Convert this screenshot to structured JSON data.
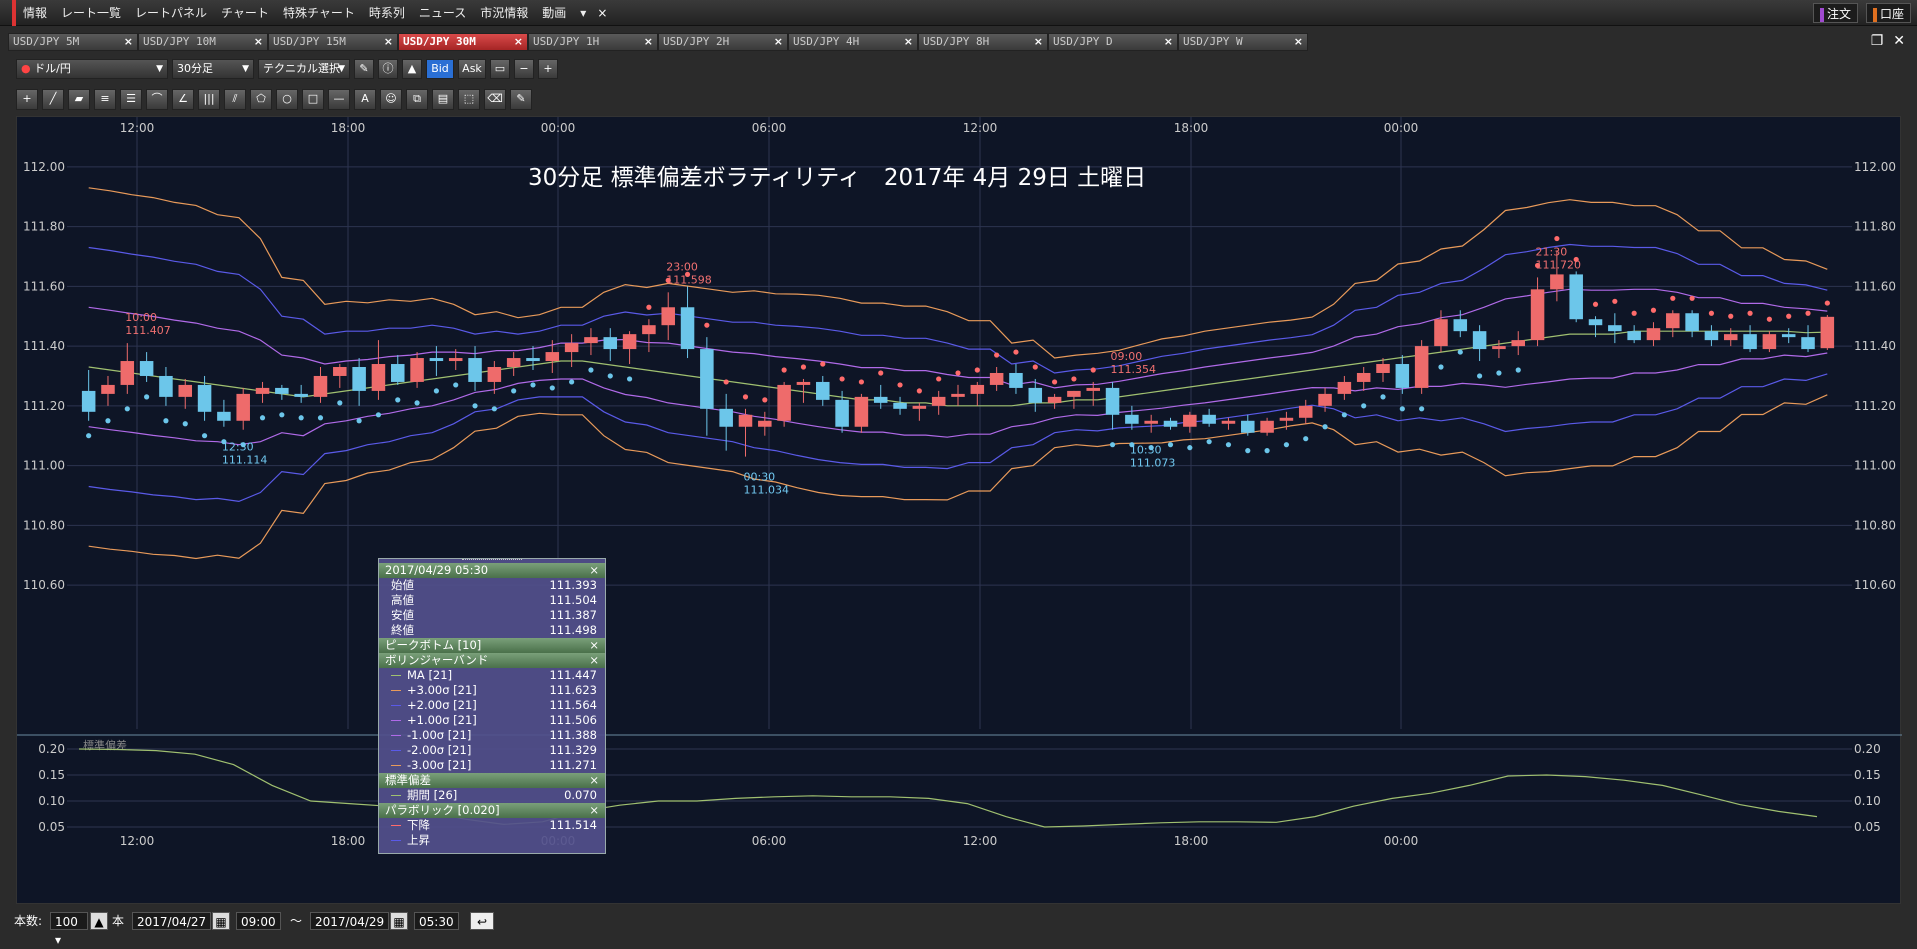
{
  "menu": {
    "items": [
      "情報",
      "レート一覧",
      "レートパネル",
      "チャート",
      "特殊チャート",
      "時系列",
      "ニュース",
      "市況情報",
      "動画"
    ],
    "more": "▾",
    "close": "×",
    "order_label": "注文",
    "account_label": "口座"
  },
  "tabs": [
    {
      "label": "USD/JPY 5M"
    },
    {
      "label": "USD/JPY 10M"
    },
    {
      "label": "USD/JPY 15M"
    },
    {
      "label": "USD/JPY 30M",
      "active": true
    },
    {
      "label": "USD/JPY 1H"
    },
    {
      "label": "USD/JPY 2H"
    },
    {
      "label": "USD/JPY 4H"
    },
    {
      "label": "USD/JPY 8H"
    },
    {
      "label": "USD/JPY D"
    },
    {
      "label": "USD/JPY W"
    }
  ],
  "toolbar": {
    "symbol": "ドル/円",
    "timeframe": "30分足",
    "technical": "テクニカル選択",
    "bid": "Bid",
    "ask": "Ask"
  },
  "chart_title": "30分足 標準偏差ボラティリティ　2017年 4月 29日 土曜日",
  "chart_data": {
    "type": "candlestick",
    "time_labels": [
      "12:00",
      "18:00",
      "00:00",
      "06:00",
      "12:00",
      "18:00",
      "00:00"
    ],
    "price_ticks": [
      "112.00",
      "111.80",
      "111.60",
      "111.40",
      "111.20",
      "111.00",
      "110.80",
      "110.60"
    ],
    "ylim": [
      110.55,
      112.1
    ],
    "candles": [
      [
        111.25,
        111.32,
        111.15,
        111.18
      ],
      [
        111.24,
        111.3,
        111.2,
        111.27
      ],
      [
        111.27,
        111.41,
        111.24,
        111.35
      ],
      [
        111.35,
        111.38,
        111.28,
        111.3
      ],
      [
        111.3,
        111.33,
        111.2,
        111.23
      ],
      [
        111.23,
        111.29,
        111.19,
        111.27
      ],
      [
        111.27,
        111.3,
        111.15,
        111.18
      ],
      [
        111.18,
        111.22,
        111.13,
        111.15
      ],
      [
        111.15,
        111.26,
        111.12,
        111.24
      ],
      [
        111.24,
        111.28,
        111.21,
        111.26
      ],
      [
        111.26,
        111.27,
        111.22,
        111.24
      ],
      [
        111.24,
        111.27,
        111.21,
        111.23
      ],
      [
        111.23,
        111.33,
        111.21,
        111.3
      ],
      [
        111.3,
        111.34,
        111.26,
        111.33
      ],
      [
        111.33,
        111.36,
        111.2,
        111.25
      ],
      [
        111.25,
        111.42,
        111.22,
        111.34
      ],
      [
        111.34,
        111.37,
        111.27,
        111.28
      ],
      [
        111.28,
        111.38,
        111.26,
        111.36
      ],
      [
        111.36,
        111.4,
        111.3,
        111.35
      ],
      [
        111.35,
        111.39,
        111.32,
        111.36
      ],
      [
        111.36,
        111.4,
        111.25,
        111.28
      ],
      [
        111.28,
        111.35,
        111.24,
        111.33
      ],
      [
        111.33,
        111.38,
        111.3,
        111.36
      ],
      [
        111.36,
        111.4,
        111.32,
        111.35
      ],
      [
        111.35,
        111.42,
        111.31,
        111.38
      ],
      [
        111.38,
        111.44,
        111.33,
        111.41
      ],
      [
        111.41,
        111.46,
        111.37,
        111.43
      ],
      [
        111.43,
        111.46,
        111.35,
        111.39
      ],
      [
        111.39,
        111.45,
        111.34,
        111.44
      ],
      [
        111.44,
        111.49,
        111.38,
        111.47
      ],
      [
        111.47,
        111.58,
        111.42,
        111.53
      ],
      [
        111.53,
        111.6,
        111.36,
        111.39
      ],
      [
        111.39,
        111.43,
        111.1,
        111.19
      ],
      [
        111.19,
        111.24,
        111.05,
        111.13
      ],
      [
        111.13,
        111.19,
        111.03,
        111.17
      ],
      [
        111.13,
        111.18,
        111.1,
        111.15
      ],
      [
        111.15,
        111.28,
        111.13,
        111.27
      ],
      [
        111.27,
        111.29,
        111.21,
        111.28
      ],
      [
        111.28,
        111.3,
        111.2,
        111.22
      ],
      [
        111.22,
        111.25,
        111.11,
        111.13
      ],
      [
        111.13,
        111.24,
        111.11,
        111.23
      ],
      [
        111.23,
        111.27,
        111.19,
        111.21
      ],
      [
        111.21,
        111.23,
        111.17,
        111.19
      ],
      [
        111.19,
        111.21,
        111.15,
        111.2
      ],
      [
        111.2,
        111.25,
        111.17,
        111.23
      ],
      [
        111.23,
        111.27,
        111.2,
        111.24
      ],
      [
        111.24,
        111.28,
        111.2,
        111.27
      ],
      [
        111.27,
        111.33,
        111.25,
        111.31
      ],
      [
        111.31,
        111.34,
        111.24,
        111.26
      ],
      [
        111.26,
        111.29,
        111.18,
        111.21
      ],
      [
        111.21,
        111.24,
        111.19,
        111.23
      ],
      [
        111.23,
        111.25,
        111.19,
        111.25
      ],
      [
        111.25,
        111.28,
        111.2,
        111.26
      ],
      [
        111.26,
        111.28,
        111.12,
        111.17
      ],
      [
        111.17,
        111.2,
        111.12,
        111.14
      ],
      [
        111.14,
        111.17,
        111.11,
        111.15
      ],
      [
        111.15,
        111.16,
        111.12,
        111.13
      ],
      [
        111.13,
        111.18,
        111.11,
        111.17
      ],
      [
        111.17,
        111.19,
        111.13,
        111.14
      ],
      [
        111.14,
        111.16,
        111.12,
        111.15
      ],
      [
        111.15,
        111.17,
        111.1,
        111.11
      ],
      [
        111.11,
        111.16,
        111.1,
        111.15
      ],
      [
        111.15,
        111.18,
        111.12,
        111.16
      ],
      [
        111.16,
        111.22,
        111.14,
        111.2
      ],
      [
        111.2,
        111.26,
        111.18,
        111.24
      ],
      [
        111.24,
        111.3,
        111.22,
        111.28
      ],
      [
        111.28,
        111.33,
        111.25,
        111.31
      ],
      [
        111.31,
        111.36,
        111.28,
        111.34
      ],
      [
        111.34,
        111.37,
        111.24,
        111.26
      ],
      [
        111.26,
        111.42,
        111.24,
        111.4
      ],
      [
        111.4,
        111.52,
        111.38,
        111.49
      ],
      [
        111.49,
        111.52,
        111.43,
        111.45
      ],
      [
        111.45,
        111.47,
        111.35,
        111.39
      ],
      [
        111.39,
        111.42,
        111.36,
        111.4
      ],
      [
        111.4,
        111.45,
        111.37,
        111.42
      ],
      [
        111.42,
        111.63,
        111.4,
        111.59
      ],
      [
        111.59,
        111.72,
        111.55,
        111.64
      ],
      [
        111.64,
        111.65,
        111.48,
        111.49
      ],
      [
        111.49,
        111.5,
        111.43,
        111.47
      ],
      [
        111.47,
        111.51,
        111.41,
        111.45
      ],
      [
        111.45,
        111.47,
        111.41,
        111.42
      ],
      [
        111.42,
        111.48,
        111.4,
        111.46
      ],
      [
        111.46,
        111.52,
        111.43,
        111.51
      ],
      [
        111.51,
        111.52,
        111.43,
        111.45
      ],
      [
        111.45,
        111.47,
        111.4,
        111.42
      ],
      [
        111.42,
        111.46,
        111.4,
        111.44
      ],
      [
        111.44,
        111.47,
        111.38,
        111.39
      ],
      [
        111.39,
        111.45,
        111.38,
        111.44
      ],
      [
        111.44,
        111.46,
        111.41,
        111.43
      ],
      [
        111.43,
        111.47,
        111.38,
        111.39
      ],
      [
        111.393,
        111.504,
        111.387,
        111.498
      ]
    ],
    "ma": [
      111.33,
      111.32,
      111.31,
      111.3,
      111.29,
      111.28,
      111.27,
      111.26,
      111.25,
      111.24,
      111.23,
      111.24,
      111.25,
      111.26,
      111.27,
      111.28,
      111.29,
      111.3,
      111.31,
      111.32,
      111.33,
      111.34,
      111.35,
      111.35,
      111.34,
      111.33,
      111.32,
      111.31,
      111.3,
      111.29,
      111.28,
      111.27,
      111.26,
      111.25,
      111.24,
      111.23,
      111.22,
      111.22,
      111.21,
      111.21,
      111.2,
      111.2,
      111.2,
      111.2,
      111.21,
      111.21,
      111.22,
      111.22,
      111.23,
      111.24,
      111.25,
      111.26,
      111.27,
      111.28,
      111.29,
      111.3,
      111.31,
      111.32,
      111.33,
      111.34,
      111.35,
      111.36,
      111.37,
      111.38,
      111.39,
      111.4,
      111.41,
      111.42,
      111.43,
      111.44,
      111.44,
      111.44,
      111.45,
      111.45,
      111.45,
      111.45,
      111.45,
      111.45,
      111.45,
      111.45,
      111.445,
      111.447
    ],
    "sd": [
      0.2,
      0.199,
      0.197,
      0.19,
      0.17,
      0.13,
      0.1,
      0.095,
      0.09,
      0.08,
      0.065,
      0.055,
      0.06,
      0.08,
      0.092,
      0.1,
      0.1,
      0.105,
      0.108,
      0.11,
      0.108,
      0.108,
      0.105,
      0.095,
      0.07,
      0.05,
      0.052,
      0.055,
      0.058,
      0.06,
      0.06,
      0.059,
      0.07,
      0.09,
      0.105,
      0.115,
      0.13,
      0.148,
      0.15,
      0.147,
      0.14,
      0.13,
      0.112,
      0.093,
      0.08,
      0.07
    ],
    "sar_down_label": {
      "time": "23:00",
      "value": "111.598"
    },
    "sar_labels": [
      {
        "time": "10:00",
        "value": "111.407"
      },
      {
        "time": "23:00",
        "value": "111.598"
      },
      {
        "time": "09:00",
        "value": "111.354"
      },
      {
        "time": "21:30",
        "value": "111.720"
      }
    ],
    "low_labels": [
      {
        "time": "12:30",
        "value": "111.114"
      },
      {
        "time": "00:30",
        "value": "111.034"
      },
      {
        "time": "10:30",
        "value": "111.073"
      }
    ],
    "sd_ticks": [
      "0.20",
      "0.15",
      "0.10",
      "0.05"
    ],
    "sd_label": "標準偏差",
    "colors": {
      "up": "#ee6b6b",
      "down": "#6cc6ea",
      "ma": "#a0c070",
      "bb1": "#b06ae8",
      "bb2": "#5a5ae8",
      "bb3": "#e89a5a",
      "sar_down": "#ff6b6b",
      "sar_up": "#6cc6ea"
    }
  },
  "tooltip": {
    "date": "2017/04/29 05:30",
    "ohlc": [
      {
        "label": "始値",
        "value": "111.393"
      },
      {
        "label": "高値",
        "value": "111.504"
      },
      {
        "label": "安値",
        "value": "111.387"
      },
      {
        "label": "終値",
        "value": "111.498"
      }
    ],
    "peak_bottom": "ピークボトム [10]",
    "bollinger": "ボリンジャーバンド",
    "bb_rows": [
      {
        "label": "MA [21]",
        "value": "111.447",
        "color": "#a0c070"
      },
      {
        "label": "+3.00σ [21]",
        "value": "111.623",
        "color": "#e89a5a"
      },
      {
        "label": "+2.00σ [21]",
        "value": "111.564",
        "color": "#5a5ae8"
      },
      {
        "label": "+1.00σ [21]",
        "value": "111.506",
        "color": "#b06ae8"
      },
      {
        "label": "-1.00σ [21]",
        "value": "111.388",
        "color": "#b06ae8"
      },
      {
        "label": "-2.00σ [21]",
        "value": "111.329",
        "color": "#5a5ae8"
      },
      {
        "label": "-3.00σ [21]",
        "value": "111.271",
        "color": "#e89a5a"
      }
    ],
    "std_title": "標準偏差",
    "std_row": {
      "label": "期間 [26]",
      "value": "0.070",
      "color": "#a0c070"
    },
    "sar_title": "パラボリック [0.020]",
    "sar_rows": [
      {
        "label": "下降",
        "value": "111.514",
        "color": "#ff6b6b"
      },
      {
        "label": "上昇",
        "value": "",
        "color": "#5a5ae8"
      }
    ],
    "close": "×"
  },
  "bottom": {
    "count_label": "本数:",
    "count_value": "100",
    "unit": "本",
    "from_date": "2017/04/27",
    "from_time": "09:00",
    "tilde": "〜",
    "to_date": "2017/04/29",
    "to_time": "05:30"
  }
}
